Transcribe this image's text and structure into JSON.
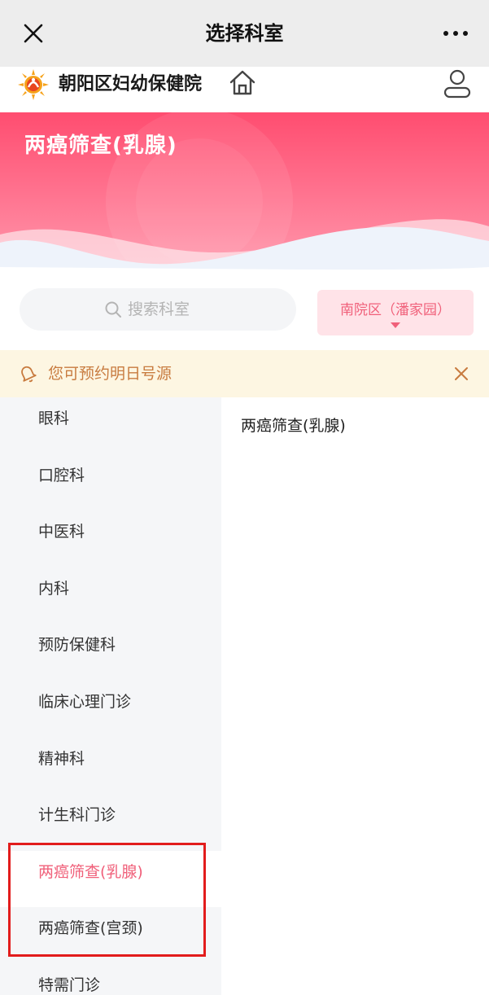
{
  "topbar": {
    "title": "选择科室"
  },
  "hospital": {
    "name": "朝阳区妇幼保健院"
  },
  "banner": {
    "title": "两癌筛查(乳腺)"
  },
  "search": {
    "placeholder": "搜索科室"
  },
  "campus": {
    "label": "南院区（潘家园）"
  },
  "notice": {
    "text": "您可预约明日号源"
  },
  "sidebar": {
    "items": [
      {
        "label": "眼科"
      },
      {
        "label": "口腔科"
      },
      {
        "label": "中医科"
      },
      {
        "label": "内科"
      },
      {
        "label": "预防保健科"
      },
      {
        "label": "临床心理门诊"
      },
      {
        "label": "精神科"
      },
      {
        "label": "计生科门诊"
      },
      {
        "label": "两癌筛查(乳腺)",
        "active": true
      },
      {
        "label": "两癌筛查(宫颈)"
      },
      {
        "label": "特需门诊"
      }
    ]
  },
  "panel": {
    "departments": [
      {
        "label": "两癌筛查(乳腺)"
      }
    ]
  },
  "colors": {
    "accent": "#f0607a",
    "highlight_box": "#e21c1c",
    "notice_text": "#c87b3f"
  },
  "icons": [
    "close-icon",
    "more-icon",
    "hospital-logo-icon",
    "home-icon",
    "user-icon",
    "search-icon",
    "caret-down-icon",
    "bell-icon",
    "notice-close-icon"
  ]
}
